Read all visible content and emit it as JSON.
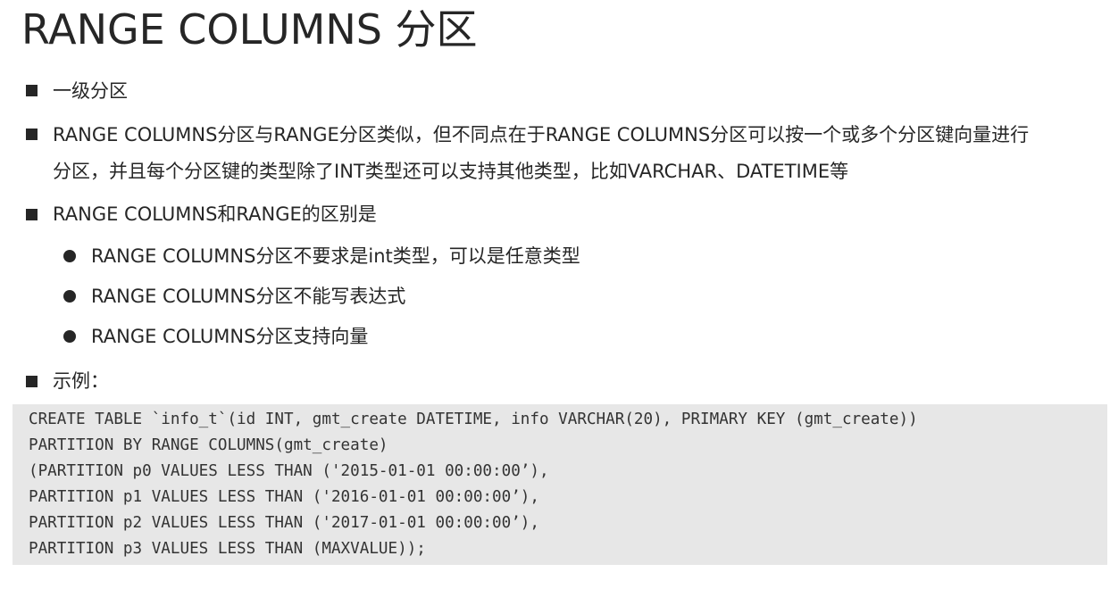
{
  "title": "RANGE COLUMNS 分区",
  "bullets": [
    {
      "text": "一级分区"
    },
    {
      "lines": [
        "RANGE COLUMNS分区与RANGE分区类似，但不同点在于RANGE COLUMNS分区可以按一个或多个分区键向量进行",
        "分区，并且每个分区键的类型除了INT类型还可以支持其他类型，比如VARCHAR、DATETIME等"
      ]
    },
    {
      "text": "RANGE COLUMNS和RANGE的区别是",
      "sub": [
        "RANGE COLUMNS分区不要求是int类型，可以是任意类型",
        "RANGE COLUMNS分区不能写表达式",
        "RANGE COLUMNS分区支持向量"
      ]
    },
    {
      "text": "示例："
    }
  ],
  "code": [
    "CREATE TABLE `info_t`(id INT, gmt_create DATETIME, info VARCHAR(20), PRIMARY KEY (gmt_create))",
    "PARTITION BY RANGE COLUMNS(gmt_create)",
    "(PARTITION p0 VALUES LESS THAN ('2015-01-01 00:00:00’),",
    "PARTITION p1 VALUES LESS THAN ('2016-01-01 00:00:00’),",
    "PARTITION p2 VALUES LESS THAN ('2017-01-01 00:00:00’),",
    "PARTITION p3 VALUES LESS THAN (MAXVALUE));"
  ]
}
